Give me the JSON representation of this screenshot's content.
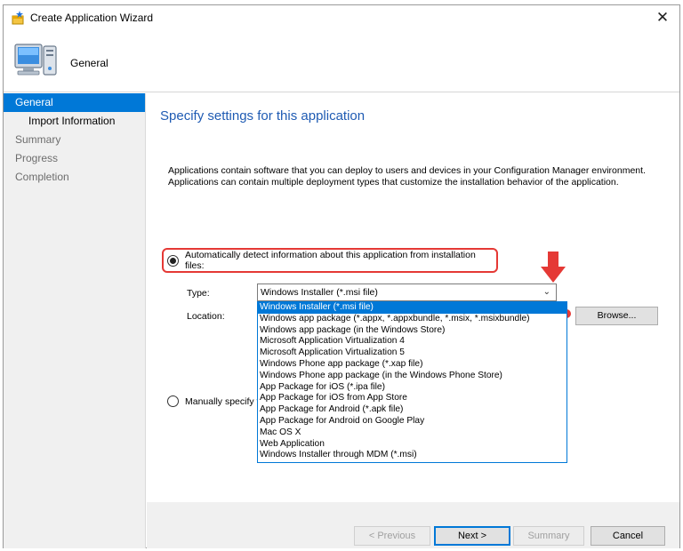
{
  "window": {
    "title": "Create Application Wizard",
    "header_title": "General",
    "close_symbol": "✕"
  },
  "sidebar": {
    "items": [
      {
        "label": "General",
        "state": "active"
      },
      {
        "label": "Import Information",
        "state": "sub"
      },
      {
        "label": "Summary",
        "state": "inactive"
      },
      {
        "label": "Progress",
        "state": "inactive"
      },
      {
        "label": "Completion",
        "state": "inactive"
      }
    ]
  },
  "content": {
    "title": "Specify settings for this application",
    "description_line1": "Applications contain software that you can deploy to users and devices in your Configuration Manager environment.",
    "description_line2": "Applications can contain multiple deployment types that customize the installation behavior of the application.",
    "auto_option_label": "Automatically detect information about this application from installation files:",
    "type_label": "Type:",
    "location_label": "Location:",
    "selected_type": "Windows Installer (*.msi file)",
    "browse_label": "Browse...",
    "manual_option_label": "Manually specify t",
    "dropdown_options": [
      "Windows Installer (*.msi file)",
      "Windows app package (*.appx, *.appxbundle, *.msix, *.msixbundle)",
      "Windows app package (in the Windows Store)",
      "Microsoft Application Virtualization 4",
      "Microsoft Application Virtualization 5",
      "Windows Phone app package (*.xap file)",
      "Windows Phone app package (in the Windows Phone Store)",
      "App Package for iOS (*.ipa file)",
      "App Package for iOS from App Store",
      "App Package for Android (*.apk file)",
      "App Package for Android on Google Play",
      "Mac OS X",
      "Web Application",
      "Windows Installer through MDM (*.msi)"
    ]
  },
  "footer": {
    "previous_label": "< Previous",
    "next_label": "Next >",
    "summary_label": "Summary",
    "cancel_label": "Cancel"
  },
  "colors": {
    "accent": "#0078d7",
    "title_blue": "#1f5bb3",
    "highlight_red": "#e53935"
  },
  "icons": {
    "title": "wizard-star-icon",
    "header": "computer-monitor-icon",
    "close": "close-icon",
    "arrow": "red-down-arrow-icon",
    "dropdown": "chevron-down-icon"
  }
}
